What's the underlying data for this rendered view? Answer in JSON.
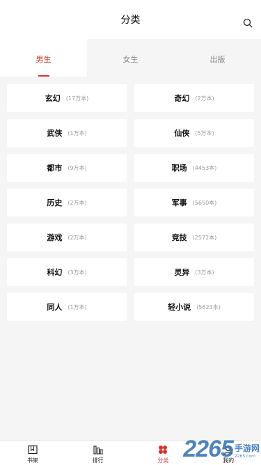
{
  "header": {
    "title": "分类"
  },
  "tabs": [
    {
      "label": "男生",
      "active": true
    },
    {
      "label": "女生",
      "active": false
    },
    {
      "label": "出版",
      "active": false
    }
  ],
  "categories": [
    {
      "name": "玄幻",
      "count": "(17万本)"
    },
    {
      "name": "奇幻",
      "count": "(2万本)"
    },
    {
      "name": "武侠",
      "count": "(1万本)"
    },
    {
      "name": "仙侠",
      "count": "(5万本)"
    },
    {
      "name": "都市",
      "count": "(9万本)"
    },
    {
      "name": "职场",
      "count": "(4453本)"
    },
    {
      "name": "历史",
      "count": "(2万本)"
    },
    {
      "name": "军事",
      "count": "(5650本)"
    },
    {
      "name": "游戏",
      "count": "(2万本)"
    },
    {
      "name": "竞技",
      "count": "(2572本)"
    },
    {
      "name": "科幻",
      "count": "(3万本)"
    },
    {
      "name": "灵异",
      "count": "(3万本)"
    },
    {
      "name": "同人",
      "count": "(1万本)"
    },
    {
      "name": "轻小说",
      "count": "(5623本)"
    }
  ],
  "bottom_nav": [
    {
      "label": "书架",
      "icon": "bookshelf-icon"
    },
    {
      "label": "排行",
      "icon": "ranking-icon"
    },
    {
      "label": "分类",
      "icon": "category-icon",
      "active": true
    },
    {
      "label": "我的",
      "icon": "profile-icon"
    }
  ],
  "watermark": {
    "number": "2265",
    "text": "手游网",
    "url": "2265.com"
  },
  "colors": {
    "accent": "#d9332f",
    "background": "#f5f5f5",
    "watermark": "#2f6fb5"
  }
}
